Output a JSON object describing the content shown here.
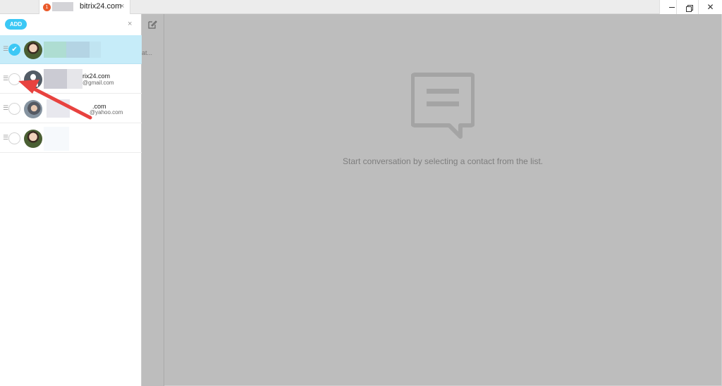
{
  "window": {
    "tab": {
      "badge": "1",
      "title": "bitrix24.com",
      "close": "×"
    },
    "controls": {
      "close": "✕"
    }
  },
  "panel": {
    "add_label": "ADD",
    "close": "×",
    "contacts": [
      {
        "name": "",
        "email": "",
        "selected": true,
        "avatar": "photo"
      },
      {
        "name": "rix24.com",
        "email": "@gmail.com",
        "selected": false,
        "avatar": "default"
      },
      {
        "name": ".com",
        "email": "@yahoo.com",
        "selected": false,
        "avatar": "photo"
      },
      {
        "name": "",
        "email": "",
        "selected": false,
        "avatar": "photo"
      }
    ]
  },
  "middle": {
    "snippet": "at..."
  },
  "content": {
    "empty_text": "Start conversation by selecting a contact from the list.",
    "icon": "chat-bubble-icon"
  },
  "colors": {
    "accent": "#3bc8f5",
    "selected_row": "#c6ecf9",
    "overlay": "#bdbdbd",
    "annotation_arrow": "#e8423f"
  }
}
